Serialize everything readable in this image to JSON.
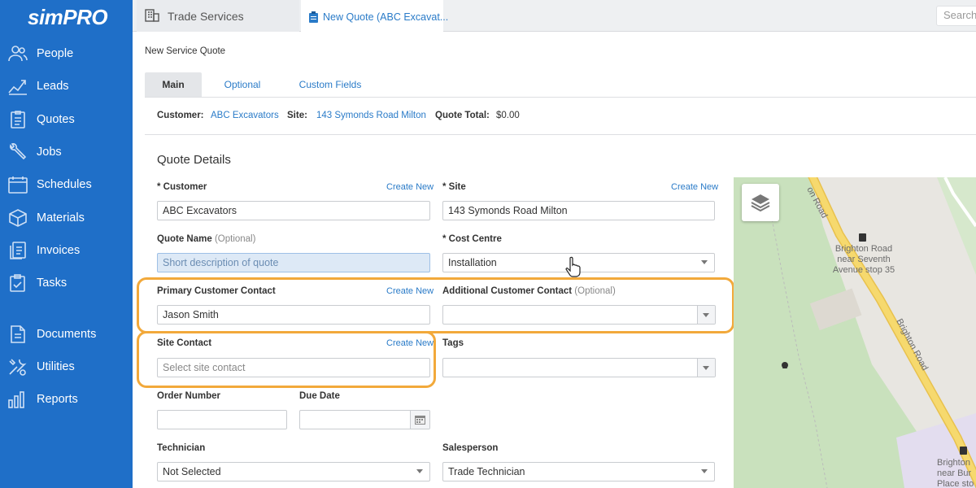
{
  "app": {
    "logo_text": "simPRO"
  },
  "sidebar": {
    "items": [
      {
        "label": "People",
        "icon": "people-icon"
      },
      {
        "label": "Leads",
        "icon": "leads-icon"
      },
      {
        "label": "Quotes",
        "icon": "quotes-icon"
      },
      {
        "label": "Jobs",
        "icon": "jobs-icon"
      },
      {
        "label": "Schedules",
        "icon": "schedules-icon"
      },
      {
        "label": "Materials",
        "icon": "materials-icon"
      },
      {
        "label": "Invoices",
        "icon": "invoices-icon"
      },
      {
        "label": "Tasks",
        "icon": "tasks-icon"
      },
      {
        "label": "Documents",
        "icon": "documents-icon"
      },
      {
        "label": "Utilities",
        "icon": "utilities-icon"
      },
      {
        "label": "Reports",
        "icon": "reports-icon"
      }
    ]
  },
  "tabs": {
    "company": "Trade Services",
    "current": "New Quote (ABC Excavat..."
  },
  "search": {
    "placeholder": "Search"
  },
  "page": {
    "title": "New Service Quote"
  },
  "subtabs": {
    "main": "Main",
    "optional": "Optional",
    "custom_fields": "Custom Fields"
  },
  "summary": {
    "customer_label": "Customer:",
    "customer_value": "ABC Excavators",
    "site_label": "Site:",
    "site_value": "143 Symonds Road Milton",
    "total_label": "Quote Total:",
    "total_value": "$0.00"
  },
  "form": {
    "section_title": "Quote Details",
    "create_new": "Create New",
    "customer": {
      "label": "* Customer",
      "value": "ABC Excavators"
    },
    "site": {
      "label": "* Site",
      "value": "143 Symonds Road Milton"
    },
    "quote_name": {
      "label": "Quote Name",
      "optional": "(Optional)",
      "placeholder": "Short description of quote"
    },
    "cost_centre": {
      "label": "* Cost Centre",
      "value": "Installation"
    },
    "primary_contact": {
      "label": "Primary Customer Contact",
      "value": "Jason Smith"
    },
    "additional_contact": {
      "label": "Additional Customer Contact",
      "optional": "(Optional)",
      "value": ""
    },
    "site_contact": {
      "label": "Site Contact",
      "placeholder": "Select site contact"
    },
    "tags": {
      "label": "Tags",
      "value": ""
    },
    "order_number": {
      "label": "Order Number",
      "value": ""
    },
    "due_date": {
      "label": "Due Date",
      "value": ""
    },
    "technician": {
      "label": "Technician",
      "value": "Not Selected"
    },
    "salesperson": {
      "label": "Salesperson",
      "value": "Trade Technician"
    }
  },
  "map": {
    "road_top": "on Road",
    "stop_label_1": "Brighton Road",
    "stop_label_2": "near Seventh",
    "stop_label_3": "Avenue stop 35",
    "road_diag": "Brighton Road",
    "bottom_1": "Brighton",
    "bottom_2": "near Bur",
    "bottom_3": "Place sto"
  },
  "colors": {
    "sidebar": "#1f6fc8",
    "link": "#2a7bc8",
    "highlight": "#f2a93b",
    "map_road": "#f5d36b",
    "map_park": "#c8e2be"
  }
}
